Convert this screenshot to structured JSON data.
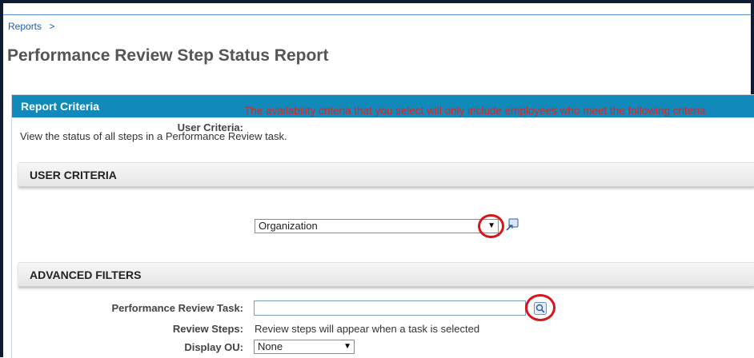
{
  "breadcrumb": {
    "link": "Reports",
    "separator": ">"
  },
  "page": {
    "title": "Performance Review Step Status Report"
  },
  "panel": {
    "header": "Report Criteria",
    "description": "View the status of all steps in a Performance Review task."
  },
  "user_criteria_section": {
    "title": "USER CRITERIA",
    "field_label": "User Criteria:",
    "warning": "The availability criteria that you select will only include employees who meet the following criteria",
    "selected": "Organization",
    "arrow": "▼"
  },
  "advanced_filters_section": {
    "title": "ADVANCED FILTERS",
    "task_label": "Performance Review Task:",
    "task_value": "",
    "steps_label": "Review Steps:",
    "steps_text": "Review steps will appear when a task is selected",
    "display_ou_label": "Display OU:",
    "display_ou_selected": "None",
    "arrow": "▼"
  },
  "colors": {
    "frame": "#0d1b33",
    "link": "#1f5fa8",
    "panel_header": "#1189bb",
    "warning": "#e0241f",
    "highlight_ring": "#d8151b"
  },
  "icons": {
    "criteria_picker": "search-popup-icon",
    "task_picker": "search-popup-icon"
  }
}
